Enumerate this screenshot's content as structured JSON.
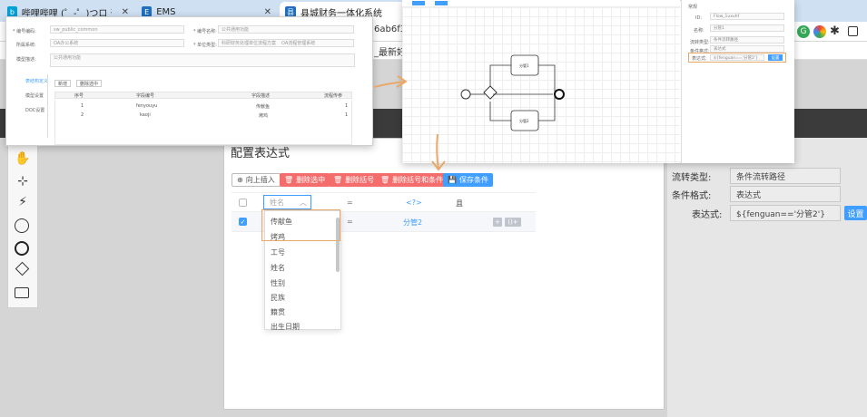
{
  "browser": {
    "tabs": [
      {
        "title": "哔哩哔哩 (゜-゜)つロ 干杯~-bilibili",
        "icon": "bilibili-icon",
        "color": "#00a1d6",
        "active": false
      },
      {
        "title": "EMS",
        "icon": "ems-icon",
        "color": "#1e6fbf",
        "active": false
      },
      {
        "title": "县城财务一体化系统",
        "icon": "finance-icon",
        "color": "#1e6fbf",
        "active": true
      }
    ],
    "close_glyph": "✕",
    "url_fragment": "6ab6f3",
    "bookmark_fragment": "_最新好"
  },
  "left_palette": {
    "tools": [
      "hand-tool-icon",
      "lasso-tool-icon",
      "connect-tool-icon",
      "start-event-icon",
      "end-event-icon",
      "gateway-icon",
      "task-icon"
    ]
  },
  "right_panel": {
    "rows": [
      {
        "label": "流转类型:",
        "value": "条件流转路径"
      },
      {
        "label": "条件格式:",
        "value": "表达式"
      },
      {
        "label": "表达式:",
        "value": "${fenguan=='分管2'}"
      }
    ],
    "set_button": "设置"
  },
  "dialog": {
    "title": "配置表达式",
    "buttons": {
      "insert_up": "向上插入",
      "delete_selected": "删除选中",
      "delete_paren": "删除括号",
      "delete_paren_cond": "删除括号和条件",
      "save_cond": "保存条件"
    },
    "header": {
      "field_placeholder": "姓名",
      "op": "=",
      "value": "<?>",
      "logic": "且"
    },
    "row": {
      "op": "=",
      "value": "分管2",
      "add": "+",
      "group": "()+"
    },
    "dropdown_options": [
      "传献鱼",
      "烤鸡",
      "工号",
      "姓名",
      "性别",
      "民族",
      "籍贯",
      "出生日期"
    ]
  },
  "overlay_form": {
    "labels": [
      "* 编号编码:",
      "* 编号名称:",
      "所属系统:",
      "* 单位类型:",
      "模型描述:"
    ],
    "values": [
      "sw_public_common",
      "公共通用功能",
      "OA办公系统",
      "科研财务处理单位流程方案",
      "OA流程管理系统"
    ],
    "desc": "公共通用功能",
    "side_tabs": [
      "表结构定义",
      "模型设置",
      "DOC设置"
    ],
    "table_buttons": [
      "新增",
      "删除选中"
    ],
    "columns": [
      "序号",
      "字段编号",
      "字段描述",
      "流程传参"
    ],
    "rows": [
      {
        "no": "1",
        "code": "fenyouyu",
        "desc": "传献鱼",
        "param": "1"
      },
      {
        "no": "2",
        "code": "kaoji",
        "desc": "烤鸡",
        "param": "1"
      }
    ]
  },
  "overlay_designer": {
    "nodes": [
      "分管1",
      "分管2"
    ],
    "side_title": "常规",
    "side_rows": [
      {
        "label": "ID:",
        "value": "Flow_1uxuhf"
      },
      {
        "label": "名称:",
        "value": "分管1"
      },
      {
        "label": "流转类型:",
        "value": "条件流转路径"
      },
      {
        "label": "条件格式:",
        "value": "表达式"
      },
      {
        "label": "表达式:",
        "value": "${fenguan=='分管2'}"
      }
    ],
    "side_button": "设置"
  },
  "colors": {
    "primary": "#409eff",
    "danger": "#f56c6c",
    "annotation": "#e8a86a"
  }
}
